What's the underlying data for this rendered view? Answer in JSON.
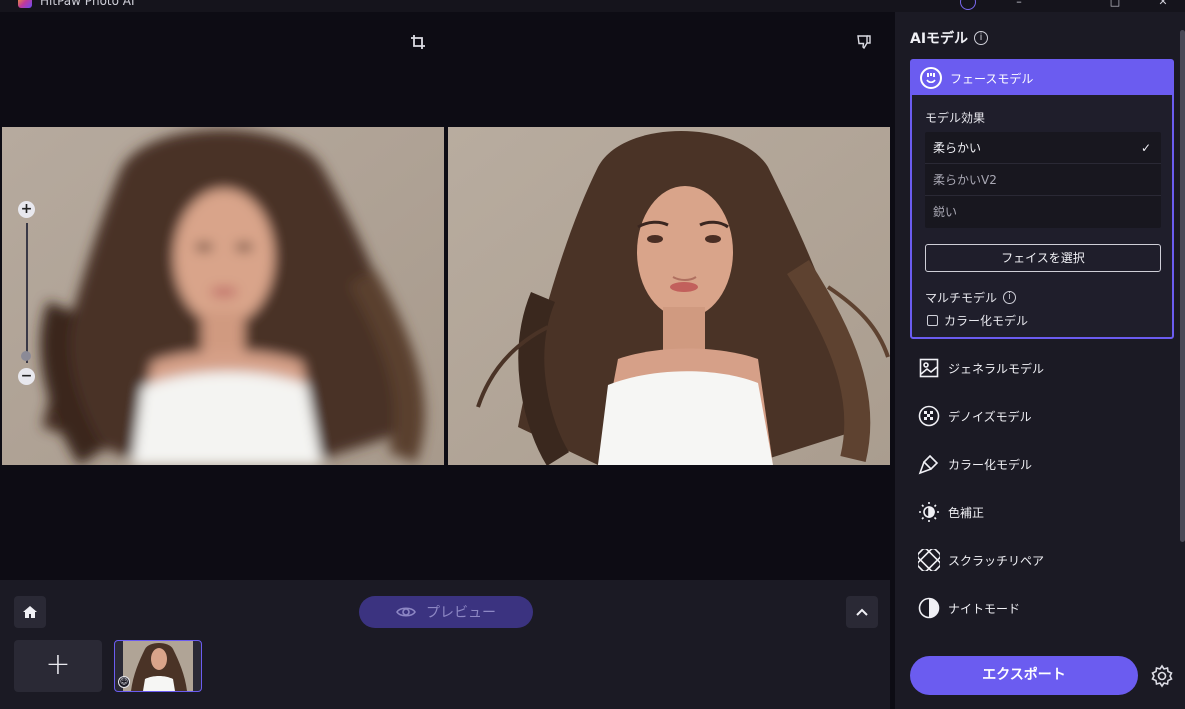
{
  "window": {
    "title": "HitPaw Photo AI"
  },
  "canvas": {
    "zoom_plus": "+",
    "zoom_minus": "−",
    "zoom_level": 0.05
  },
  "bottom": {
    "preview_label": "プレビュー",
    "add_label": "+"
  },
  "panel": {
    "title": "AIモデル",
    "face_model": {
      "label": "フェースモデル",
      "effect_label": "モデル効果",
      "options": [
        "柔らかい",
        "柔らかいV2",
        "鋭い"
      ],
      "selected_option": "柔らかい",
      "select_face_button": "フェイスを選択",
      "multi_model_label": "マルチモデル",
      "colorize_checkbox": "カラー化モデル",
      "colorize_checked": false
    },
    "models": [
      {
        "label": "ジェネラルモデル",
        "icon": "image-icon"
      },
      {
        "label": "デノイズモデル",
        "icon": "denoise-icon"
      },
      {
        "label": "カラー化モデル",
        "icon": "brush-icon"
      },
      {
        "label": "色補正",
        "icon": "sun-icon"
      },
      {
        "label": "スクラッチリペア",
        "icon": "bandage-icon"
      },
      {
        "label": "ナイトモード",
        "icon": "half-moon-icon"
      }
    ],
    "export_label": "エクスポート"
  },
  "colors": {
    "accent": "#6b5cf0",
    "panel_bg": "#1b1a24",
    "canvas_bg": "#0d0c14"
  }
}
